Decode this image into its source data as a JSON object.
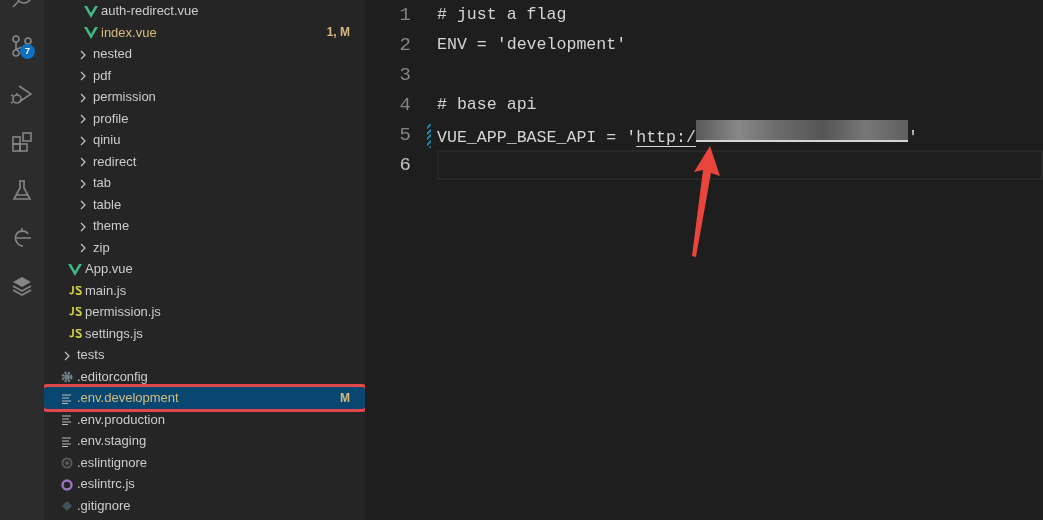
{
  "activity_bar": [
    {
      "kind": "search"
    },
    {
      "kind": "source-control",
      "badge": "7"
    },
    {
      "kind": "run"
    },
    {
      "kind": "extensions"
    },
    {
      "kind": "testing"
    },
    {
      "kind": "remote"
    },
    {
      "kind": "layers"
    }
  ],
  "explorer": {
    "tree": [
      {
        "children": [
          {
            "children": [
              {
                "children": [
                  {
                    "label": "auth-redirect.vue",
                    "kind": "vue",
                    "selected": false
                  },
                  {
                    "label": "index.vue",
                    "kind": "vue",
                    "status": "1, M",
                    "modified": true,
                    "selected": false
                  }
                ]
              },
              {
                "label": "nested",
                "kind": "folder",
                "expanded": false,
                "selected": false
              },
              {
                "label": "pdf",
                "kind": "folder",
                "expanded": false,
                "selected": false
              },
              {
                "label": "permission",
                "kind": "folder",
                "expanded": false,
                "selected": false
              },
              {
                "label": "profile",
                "kind": "folder",
                "expanded": false,
                "selected": false
              },
              {
                "label": "qiniu",
                "kind": "folder",
                "expanded": false,
                "selected": false
              },
              {
                "label": "redirect",
                "kind": "folder",
                "expanded": false,
                "selected": false
              },
              {
                "label": "tab",
                "kind": "folder",
                "expanded": false,
                "selected": false
              },
              {
                "label": "table",
                "kind": "folder",
                "expanded": false,
                "selected": false
              },
              {
                "label": "theme",
                "kind": "folder",
                "expanded": false,
                "selected": false
              },
              {
                "label": "zip",
                "kind": "folder",
                "expanded": false,
                "selected": false
              }
            ]
          },
          {
            "label": "App.vue",
            "kind": "vue",
            "selected": false
          },
          {
            "label": "main.js",
            "kind": "js",
            "selected": false
          },
          {
            "label": "permission.js",
            "kind": "js",
            "selected": false
          },
          {
            "label": "settings.js",
            "kind": "js",
            "selected": false
          }
        ]
      },
      {
        "label": "tests",
        "kind": "folder",
        "expanded": false,
        "selected": false
      },
      {
        "label": ".editorconfig",
        "kind": "gear",
        "selected": false
      },
      {
        "label": ".env.development",
        "kind": "env",
        "status": "M",
        "modified": true,
        "selected": true,
        "highlighted": true
      },
      {
        "label": ".env.production",
        "kind": "env",
        "selected": false
      },
      {
        "label": ".env.staging",
        "kind": "env",
        "selected": false
      },
      {
        "label": ".eslintignore",
        "kind": "ignore",
        "selected": false
      },
      {
        "label": ".eslintrc.js",
        "kind": "eslint",
        "selected": false
      },
      {
        "label": ".gitignore",
        "kind": "git",
        "selected": false
      }
    ]
  },
  "editor": {
    "lines": [
      {
        "number": "1",
        "parts": [
          {
            "kind": "text",
            "text": "# just a flag"
          }
        ]
      },
      {
        "number": "2",
        "parts": [
          {
            "kind": "text",
            "text": "ENV = 'development'"
          }
        ]
      },
      {
        "number": "3"
      },
      {
        "number": "4",
        "parts": [
          {
            "kind": "text",
            "text": "# base api"
          }
        ]
      },
      {
        "number": "5",
        "modified": true,
        "parts": [
          {
            "kind": "text",
            "text": "VUE_APP_BASE_API = '"
          },
          {
            "kind": "link",
            "text": "http:/"
          },
          {
            "kind": "redacted"
          },
          {
            "kind": "text",
            "text": "'"
          }
        ]
      },
      {
        "number": "6",
        "current": true
      }
    ],
    "annotation_arrow": true
  }
}
